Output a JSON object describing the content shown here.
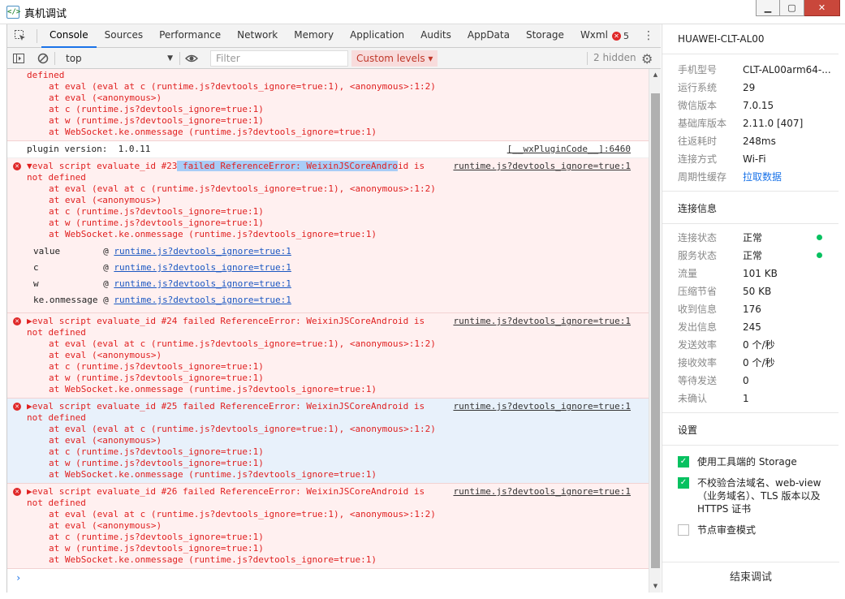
{
  "window": {
    "title": "真机调试",
    "app_icon": "</>"
  },
  "devtools": {
    "tabs": [
      "Console",
      "Sources",
      "Performance",
      "Network",
      "Memory",
      "Application",
      "Audits",
      "AppData",
      "Storage",
      "Wxml"
    ],
    "error_count": "5",
    "toolbar": {
      "context": "top",
      "filter_placeholder": "Filter",
      "levels": "Custom levels ▾",
      "hidden": "2 hidden"
    }
  },
  "console": {
    "partial": {
      "line1": "defined",
      "stack": [
        "at eval (eval at c (runtime.js?devtools_ignore=true:1), <anonymous>:1:2)",
        "at eval (<anonymous>)",
        "at c (runtime.js?devtools_ignore=true:1)",
        "at w (runtime.js?devtools_ignore=true:1)",
        "at WebSocket.ke.onmessage (runtime.js?devtools_ignore=true:1)"
      ]
    },
    "info": {
      "text": "plugin version:  1.0.11",
      "source": "[__wxPluginCode__]:6460"
    },
    "err23": {
      "pre": "▼eval script evaluate_id #23",
      "hl": " failed ReferenceError: WeixinJSCoreAndro",
      "post": "id is",
      "line2": "not defined",
      "source": "runtime.js?devtools_ignore=true:1",
      "stack": [
        "at eval (eval at c (runtime.js?devtools_ignore=true:1), <anonymous>:1:2)",
        "at eval (<anonymous>)",
        "at c (runtime.js?devtools_ignore=true:1)",
        "at w (runtime.js?devtools_ignore=true:1)",
        "at WebSocket.ke.onmessage (runtime.js?devtools_ignore=true:1)"
      ],
      "props": [
        {
          "name": "value        @ ",
          "link": "runtime.js?devtools_ignore=true:1"
        },
        {
          "name": "c            @ ",
          "link": "runtime.js?devtools_ignore=true:1"
        },
        {
          "name": "w            @ ",
          "link": "runtime.js?devtools_ignore=true:1"
        },
        {
          "name": "ke.onmessage @ ",
          "link": "runtime.js?devtools_ignore=true:1"
        }
      ]
    },
    "err24": {
      "line1": "▶eval script evaluate_id #24 failed ReferenceError: WeixinJSCoreAndroid is",
      "line2": "not defined",
      "source": "runtime.js?devtools_ignore=true:1",
      "stack": [
        "at eval (eval at c (runtime.js?devtools_ignore=true:1), <anonymous>:1:2)",
        "at eval (<anonymous>)",
        "at c (runtime.js?devtools_ignore=true:1)",
        "at w (runtime.js?devtools_ignore=true:1)",
        "at WebSocket.ke.onmessage (runtime.js?devtools_ignore=true:1)"
      ]
    },
    "err25": {
      "line1": "▶eval script evaluate_id #25 failed ReferenceError: WeixinJSCoreAndroid is",
      "line2": "not defined",
      "source": "runtime.js?devtools_ignore=true:1",
      "stack": [
        "at eval (eval at c (runtime.js?devtools_ignore=true:1), <anonymous>:1:2)",
        "at eval (<anonymous>)",
        "at c (runtime.js?devtools_ignore=true:1)",
        "at w (runtime.js?devtools_ignore=true:1)",
        "at WebSocket.ke.onmessage (runtime.js?devtools_ignore=true:1)"
      ]
    },
    "err26": {
      "line1": "▶eval script evaluate_id #26 failed ReferenceError: WeixinJSCoreAndroid is",
      "line2": "not defined",
      "source": "runtime.js?devtools_ignore=true:1",
      "stack": [
        "at eval (eval at c (runtime.js?devtools_ignore=true:1), <anonymous>:1:2)",
        "at eval (<anonymous>)",
        "at c (runtime.js?devtools_ignore=true:1)",
        "at w (runtime.js?devtools_ignore=true:1)",
        "at WebSocket.ke.onmessage (runtime.js?devtools_ignore=true:1)"
      ]
    },
    "prompt": "›"
  },
  "panel": {
    "device_name": "HUAWEI-CLT-AL00",
    "device_info": [
      {
        "k": "手机型号",
        "v": "CLT-AL00arm64-..."
      },
      {
        "k": "运行系统",
        "v": "29"
      },
      {
        "k": "微信版本",
        "v": "7.0.15"
      },
      {
        "k": "基础库版本",
        "v": "2.11.0 [407]"
      },
      {
        "k": "往返耗时",
        "v": "248ms"
      },
      {
        "k": "连接方式",
        "v": "Wi-Fi"
      },
      {
        "k": "周期性缓存",
        "v": "拉取数据"
      }
    ],
    "conn_title": "连接信息",
    "conn_info": [
      {
        "k": "连接状态",
        "v": "正常"
      },
      {
        "k": "服务状态",
        "v": "正常"
      },
      {
        "k": "流量",
        "v": "101 KB"
      },
      {
        "k": "压缩节省",
        "v": "50 KB"
      },
      {
        "k": "收到信息",
        "v": "176"
      },
      {
        "k": "发出信息",
        "v": "245"
      },
      {
        "k": "发送效率",
        "v": "0 个/秒"
      },
      {
        "k": "接收效率",
        "v": "0 个/秒"
      },
      {
        "k": "等待发送",
        "v": "0"
      },
      {
        "k": "未确认",
        "v": "1"
      }
    ],
    "settings_title": "设置",
    "settings": [
      {
        "label": "使用工具端的 Storage",
        "checked": true
      },
      {
        "label": "不校验合法域名、web-view（业务域名）、TLS 版本以及 HTTPS 证书",
        "checked": true
      },
      {
        "label": "节点审查模式",
        "checked": false
      }
    ],
    "end_button": "结束调试",
    "status_color": "#07c160"
  }
}
